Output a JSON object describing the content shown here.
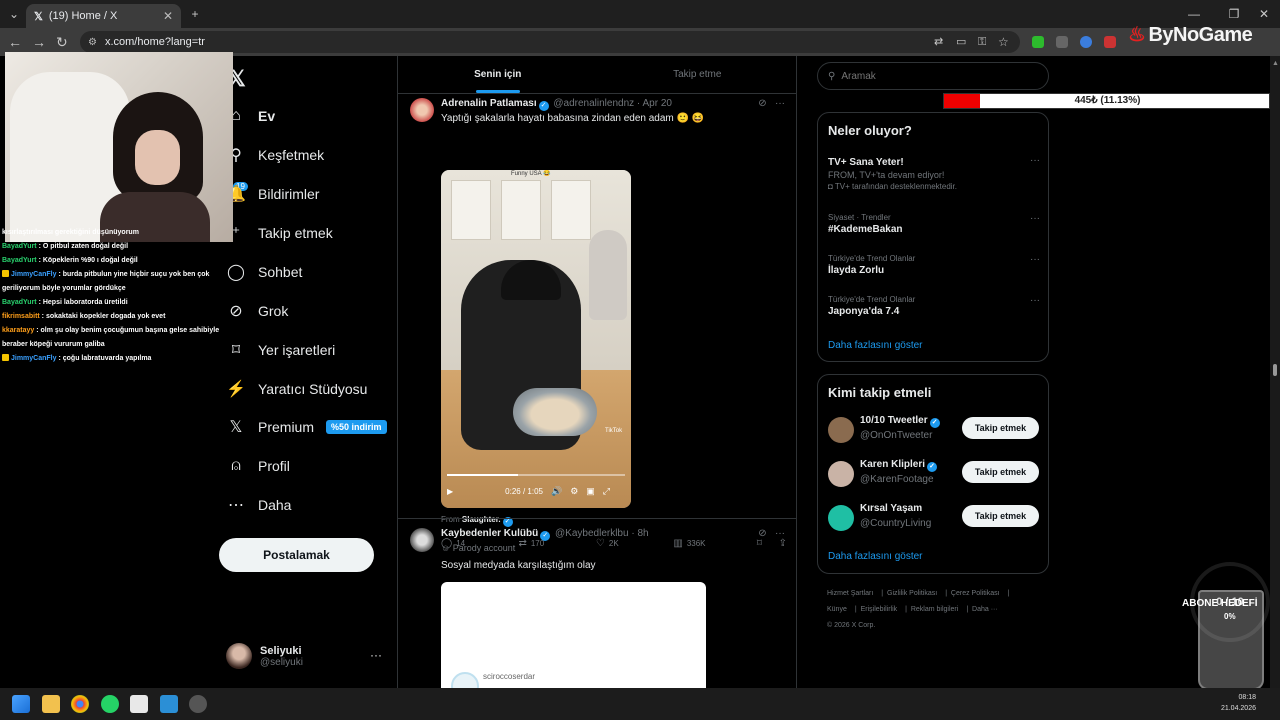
{
  "browser": {
    "tab_title": "(19) Home / X",
    "url": "x.com/home?lang=tr"
  },
  "stream": {
    "brand": "ByNoGame",
    "goal_text": "445₺ (11.13%)",
    "goal_fraction": 0.1113,
    "sub_counter": "0 / 10",
    "sub_goal_label": "ABONE HEDEFİ",
    "sub_goal_percent": "0%"
  },
  "chat": [
    {
      "user": "",
      "msg": "kısırlaştırılması gerektiğini düşünüyorum",
      "color": "w"
    },
    {
      "user": "BayadYurt",
      "msg": ": O pitbul zaten doğal değil",
      "color": "g"
    },
    {
      "user": "BayadYurt",
      "msg": ": Köpeklerin %90 ı doğal değil",
      "color": "g"
    },
    {
      "user": "JimmyCanFly",
      "msg": ": burda pitbulun yine hiçbir suçu yok ben çok geriliyorum böyle yorumlar gördükçe",
      "color": "b",
      "emote": true
    },
    {
      "user": "BayadYurt",
      "msg": ": Hepsi laboratorda üretildi",
      "color": "g"
    },
    {
      "user": "fikrimsabitt",
      "msg": ": sokaktaki kopekler dogada yok evet",
      "color": "o"
    },
    {
      "user": "kkaratayy",
      "msg": ": olm şu olay benim çocuğumun başına gelse sahibiyle beraber köpeği vururum galiba",
      "color": "o"
    },
    {
      "user": "JimmyCanFly",
      "msg": ": çoğu labratuvarda yapılma",
      "color": "b",
      "emote": true
    }
  ],
  "nav": {
    "items": [
      {
        "label": "Ev",
        "icon": "home-icon",
        "glyph": "⌂"
      },
      {
        "label": "Keşfetmek",
        "icon": "search-icon",
        "glyph": "⚲"
      },
      {
        "label": "Bildirimler",
        "icon": "bell-icon",
        "glyph": "🔔"
      },
      {
        "label": "Takip etmek",
        "icon": "add-person-icon",
        "glyph": "⁺"
      },
      {
        "label": "Sohbet",
        "icon": "chat-icon",
        "glyph": "◯"
      },
      {
        "label": "Grok",
        "icon": "grok-icon",
        "glyph": "⊘"
      },
      {
        "label": "Yer işaretleri",
        "icon": "bookmark-icon",
        "glyph": "⌑"
      },
      {
        "label": "Yaratıcı Stüdyosu",
        "icon": "creator-studio-icon",
        "glyph": "⚡"
      },
      {
        "label": "Premium",
        "icon": "x-premium-icon",
        "glyph": "𝕏"
      },
      {
        "label": "Profil",
        "icon": "person-icon",
        "glyph": "⍝"
      },
      {
        "label": "Daha",
        "icon": "more-circle-icon",
        "glyph": "⋯"
      }
    ],
    "notif_count": "19",
    "premium_badge": "%50 indirim",
    "post_button": "Postalamak"
  },
  "account": {
    "name": "Seliyuki",
    "handle": "@seliyuki"
  },
  "feed": {
    "tabs": [
      "Senin için",
      "Takip etme"
    ],
    "tweets": [
      {
        "name": "Adrenalin Patlaması",
        "handle": "@adrenalinlendnz",
        "time": "Apr 20",
        "text": "Yaptığı şakalarla hayatı babasına zindan eden adam 🙂 😆",
        "video_overlay_text": "Funny USA 😂",
        "video_watermark": "TikTok",
        "video_time": "0:26 / 1:05",
        "video_progress": 0.4,
        "from_label": "From",
        "from_source": "Slaughter.",
        "replies": "14",
        "reposts": "170",
        "likes": "2K",
        "views": "336K"
      },
      {
        "name": "Kaybedenler Kulübü",
        "handle": "@Kaybedlerklbu",
        "time": "8h",
        "parody": "Parody account",
        "text": "Sosyal medyada karşılaştığım olay",
        "embed_user": "sciroccoserdar"
      }
    ]
  },
  "search": {
    "placeholder": "Aramak"
  },
  "trends": {
    "title": "Neler oluyor?",
    "items": [
      {
        "category": "",
        "title": "TV+ Sana Yeter!",
        "sub": "FROM, TV+'ta devam ediyor!",
        "sub2": "TV+ tarafından desteklenmektedir."
      },
      {
        "category": "Siyaset · Trendler",
        "title": "#KademeBakan"
      },
      {
        "category": "Türkiye'de Trend Olanlar",
        "title": "İlayda Zorlu"
      },
      {
        "category": "Türkiye'de Trend Olanlar",
        "title": "Japonya'da 7.4"
      }
    ],
    "show_more": "Daha fazlasını göster"
  },
  "who_to_follow": {
    "title": "Kimi takip etmeli",
    "items": [
      {
        "name": "10/10 Tweetler",
        "handle": "@OnOnTweeter",
        "color": "#8a6b4f"
      },
      {
        "name": "Karen Klipleri",
        "handle": "@KarenFootage",
        "color": "#c9b3a6"
      },
      {
        "name": "Kırsal Yaşam",
        "handle": "@CountryLiving",
        "color": "#1fbfa4"
      }
    ],
    "follow_label": "Takip etmek",
    "show_more": "Daha fazlasını göster"
  },
  "footer": {
    "links": [
      "Hizmet Şartları",
      "Gizlilik Politikası",
      "Çerez Politikası",
      "Künye",
      "Erişilebilirlik",
      "Reklam bilgileri",
      "Daha ···"
    ],
    "copyright": "© 2026 X Corp."
  },
  "taskbar": {
    "time": "08:18",
    "date": "21.04.2026"
  },
  "colors": {
    "accent": "#1d9bf0",
    "background": "#000000",
    "goal_red": "#ee0000"
  }
}
